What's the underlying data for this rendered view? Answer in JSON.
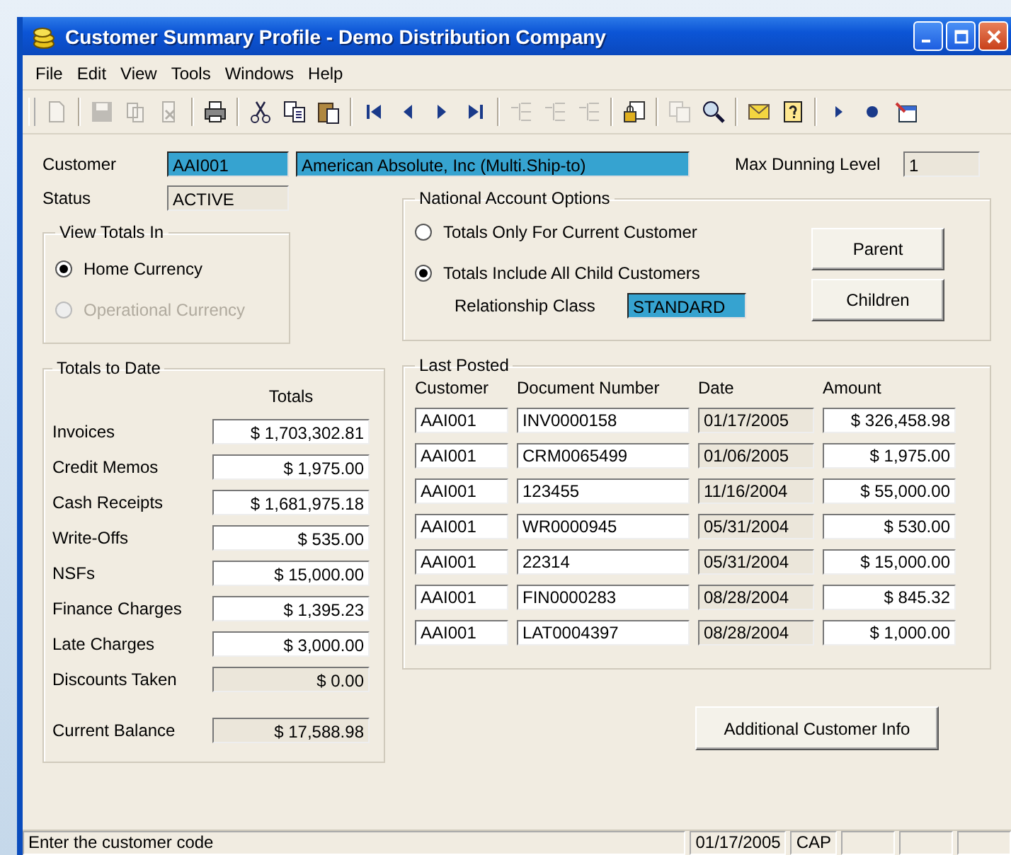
{
  "window": {
    "title": "Customer Summary Profile - Demo Distribution Company"
  },
  "menu": [
    "File",
    "Edit",
    "View",
    "Tools",
    "Windows",
    "Help"
  ],
  "toolbar": [
    [
      {
        "kind": "new",
        "disabled": true
      }
    ],
    [
      {
        "kind": "save",
        "disabled": true
      },
      {
        "kind": "save-as",
        "disabled": true
      },
      {
        "kind": "delete",
        "disabled": true
      }
    ],
    [
      {
        "kind": "print",
        "disabled": false
      }
    ],
    [
      {
        "kind": "cut",
        "disabled": false
      },
      {
        "kind": "copy",
        "disabled": false
      },
      {
        "kind": "paste",
        "disabled": false
      }
    ],
    [
      {
        "kind": "first",
        "disabled": false
      },
      {
        "kind": "prev",
        "disabled": false
      },
      {
        "kind": "next",
        "disabled": false
      },
      {
        "kind": "last",
        "disabled": false
      }
    ],
    [
      {
        "kind": "tree",
        "disabled": true
      },
      {
        "kind": "tree",
        "disabled": true
      },
      {
        "kind": "tree",
        "disabled": true
      }
    ],
    [
      {
        "kind": "lock",
        "disabled": false
      }
    ],
    [
      {
        "kind": "docs",
        "disabled": true
      },
      {
        "kind": "search",
        "disabled": false
      }
    ],
    [
      {
        "kind": "mail",
        "disabled": false
      },
      {
        "kind": "help",
        "disabled": false
      }
    ],
    [
      {
        "kind": "play",
        "disabled": false
      },
      {
        "kind": "record",
        "disabled": false
      },
      {
        "kind": "note",
        "disabled": false
      }
    ]
  ],
  "customer": {
    "label": "Customer",
    "code": "AAI001",
    "name": "American Absolute, Inc (Multi.Ship-to)"
  },
  "max_dunning": {
    "label": "Max Dunning Level",
    "value": "1"
  },
  "status": {
    "label": "Status",
    "value": "ACTIVE"
  },
  "view_totals": {
    "title": "View Totals In",
    "options": [
      {
        "label": "Home Currency",
        "selected": true,
        "disabled": false
      },
      {
        "label": "Operational Currency",
        "selected": false,
        "disabled": true
      }
    ]
  },
  "national": {
    "title": "National Account Options",
    "options": [
      {
        "label": "Totals Only For Current Customer",
        "selected": false,
        "disabled": false
      },
      {
        "label": "Totals Include All Child Customers",
        "selected": true,
        "disabled": false
      }
    ],
    "relationship": {
      "label": "Relationship Class",
      "value": "STANDARD"
    },
    "buttons": [
      "Parent",
      "Children"
    ]
  },
  "totals": {
    "title": "Totals to Date",
    "column": "Totals",
    "rows": [
      {
        "label": "Invoices",
        "value": "$ 1,703,302.81",
        "readonly": false
      },
      {
        "label": "Credit Memos",
        "value": "$ 1,975.00",
        "readonly": false
      },
      {
        "label": "Cash Receipts",
        "value": "$ 1,681,975.18",
        "readonly": false
      },
      {
        "label": "Write-Offs",
        "value": "$ 535.00",
        "readonly": false
      },
      {
        "label": "NSFs",
        "value": "$ 15,000.00",
        "readonly": false
      },
      {
        "label": "Finance Charges",
        "value": "$ 1,395.23",
        "readonly": false
      },
      {
        "label": "Late Charges",
        "value": "$ 3,000.00",
        "readonly": false
      },
      {
        "label": "Discounts Taken",
        "value": "$ 0.00",
        "readonly": true
      }
    ],
    "balance": {
      "label": "Current Balance",
      "value": "$ 17,588.98"
    }
  },
  "last_posted": {
    "title": "Last Posted",
    "columns": [
      "Customer",
      "Document Number",
      "Date",
      "Amount"
    ],
    "rows": [
      {
        "customer": "AAI001",
        "document": "INV0000158",
        "date": "01/17/2005",
        "amount": "$ 326,458.98"
      },
      {
        "customer": "AAI001",
        "document": "CRM0065499",
        "date": "01/06/2005",
        "amount": "$ 1,975.00"
      },
      {
        "customer": "AAI001",
        "document": "123455",
        "date": "11/16/2004",
        "amount": "$ 55,000.00"
      },
      {
        "customer": "AAI001",
        "document": "WR0000945",
        "date": "05/31/2004",
        "amount": "$ 530.00"
      },
      {
        "customer": "AAI001",
        "document": "22314",
        "date": "05/31/2004",
        "amount": "$ 15,000.00"
      },
      {
        "customer": "AAI001",
        "document": "FIN0000283",
        "date": "08/28/2004",
        "amount": "$ 845.32"
      },
      {
        "customer": "AAI001",
        "document": "LAT0004397",
        "date": "08/28/2004",
        "amount": "$ 1,000.00"
      }
    ]
  },
  "additional_button": "Additional Customer Info",
  "status_bar": {
    "message": "Enter the customer code",
    "date": "01/17/2005",
    "caps": "CAP"
  }
}
